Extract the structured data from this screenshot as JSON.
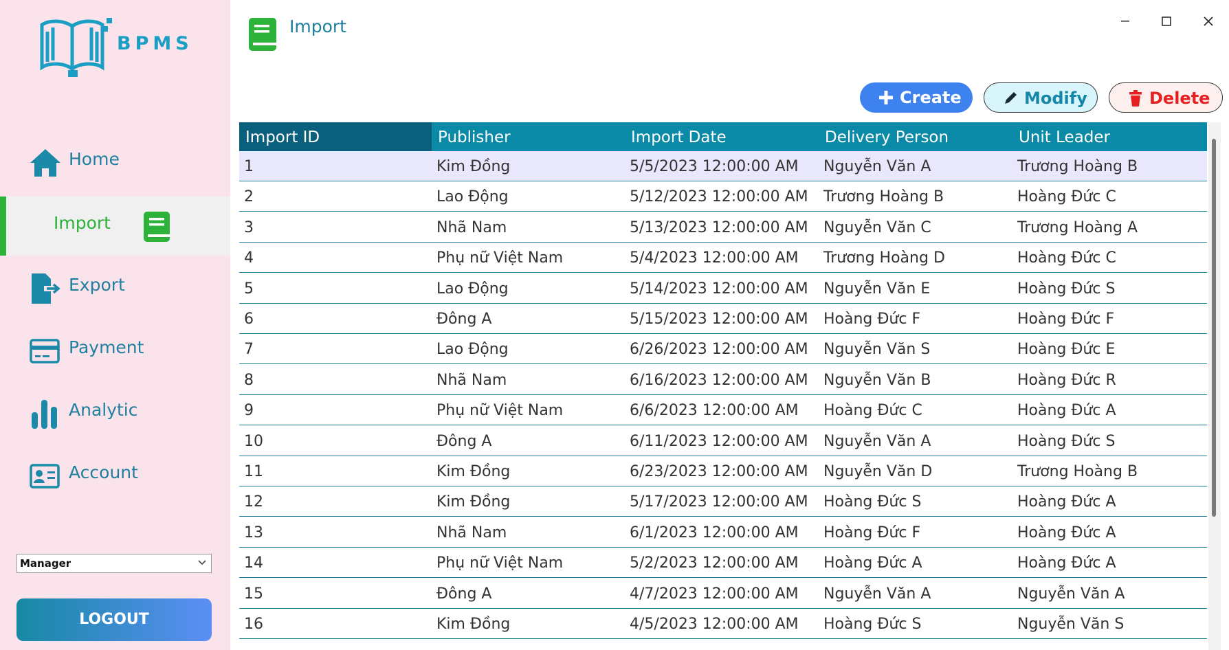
{
  "app": {
    "logo_text": "BPMS",
    "page_title": "Import",
    "accent_color": "#0b8aa7",
    "active_color": "#2eb33a"
  },
  "sidebar": {
    "items": [
      {
        "label": "Home",
        "icon": "home-icon"
      },
      {
        "label": "Import",
        "icon": "book-icon"
      },
      {
        "label": "Export",
        "icon": "file-export-icon"
      },
      {
        "label": "Payment",
        "icon": "credit-card-icon"
      },
      {
        "label": "Analytic",
        "icon": "bar-chart-icon"
      },
      {
        "label": "Account",
        "icon": "id-card-icon"
      }
    ],
    "role_select": {
      "value": "Manager"
    },
    "logout_label": "LOGOUT"
  },
  "toolbar": {
    "create_label": "Create",
    "modify_label": "Modify",
    "delete_label": "Delete"
  },
  "table": {
    "columns": [
      "Import ID",
      "Publisher",
      "Import Date",
      "Delivery Person",
      "Unit Leader"
    ],
    "selected_row": 0,
    "rows": [
      [
        "1",
        "Kim Đồng",
        "5/5/2023 12:00:00 AM",
        "Nguyễn Văn A",
        "Trương Hoàng B"
      ],
      [
        "2",
        "Lao Động",
        "5/12/2023 12:00:00 AM",
        "Trương Hoàng B",
        "Hoàng Đức C"
      ],
      [
        "3",
        "Nhã Nam",
        "5/13/2023 12:00:00 AM",
        "Nguyễn Văn C",
        "Trương Hoàng A"
      ],
      [
        "4",
        "Phụ nữ Việt Nam",
        "5/4/2023 12:00:00 AM",
        "Trương Hoàng D",
        "Hoàng Đức C"
      ],
      [
        "5",
        "Lao Động",
        "5/14/2023 12:00:00 AM",
        "Nguyễn Văn E",
        "Hoàng Đức S"
      ],
      [
        "6",
        "Đông A",
        "5/15/2023 12:00:00 AM",
        "Hoàng Đức F",
        "Hoàng Đức F"
      ],
      [
        "7",
        "Lao Động",
        "6/26/2023 12:00:00 AM",
        "Nguyễn Văn S",
        "Hoàng Đức E"
      ],
      [
        "8",
        "Nhã Nam",
        "6/16/2023 12:00:00 AM",
        "Nguyễn Văn B",
        "Hoàng Đức R"
      ],
      [
        "9",
        "Phụ nữ Việt Nam",
        "6/6/2023 12:00:00 AM",
        "Hoàng Đức C",
        "Hoàng Đức A"
      ],
      [
        "10",
        "Đông A",
        "6/11/2023 12:00:00 AM",
        "Nguyễn Văn A",
        "Hoàng Đức S"
      ],
      [
        "11",
        "Kim Đồng",
        "6/23/2023 12:00:00 AM",
        "Nguyễn Văn D",
        "Trương Hoàng B"
      ],
      [
        "12",
        "Kim Đồng",
        "5/17/2023 12:00:00 AM",
        "Hoàng Đức S",
        "Hoàng Đức A"
      ],
      [
        "13",
        "Nhã Nam",
        "6/1/2023 12:00:00 AM",
        "Hoàng Đức F",
        "Hoàng Đức A"
      ],
      [
        "14",
        "Phụ nữ Việt Nam",
        "5/2/2023 12:00:00 AM",
        "Hoàng Đức A",
        "Hoàng Đức A"
      ],
      [
        "15",
        "Đông A",
        "4/7/2023 12:00:00 AM",
        "Nguyễn Văn A",
        "Nguyễn Văn A"
      ],
      [
        "16",
        "Kim Đồng",
        "4/5/2023 12:00:00 AM",
        "Hoàng Đức S",
        "Nguyễn Văn S"
      ]
    ]
  }
}
